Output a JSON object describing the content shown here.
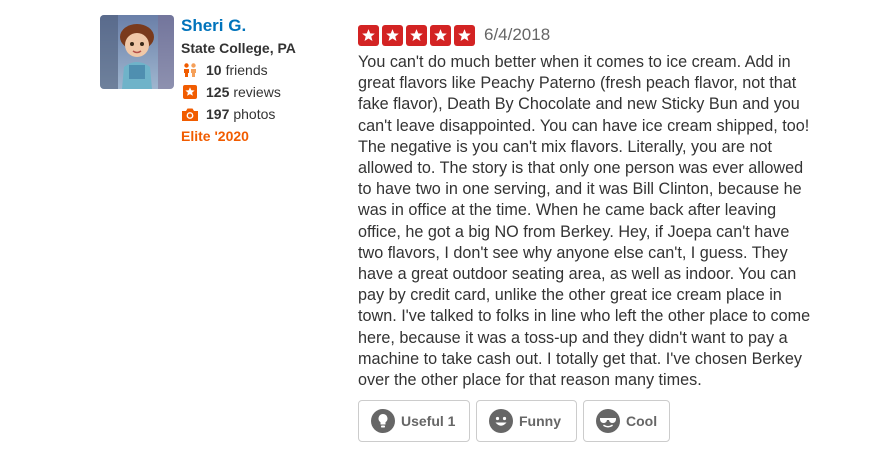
{
  "user": {
    "name": "Sheri G.",
    "location": "State College, PA",
    "friends": {
      "count": "10",
      "label": "friends",
      "icon": "friends-icon"
    },
    "reviews": {
      "count": "125",
      "label": "reviews",
      "icon": "star-icon"
    },
    "photos": {
      "count": "197",
      "label": "photos",
      "icon": "camera-icon"
    },
    "elite": "Elite '2020"
  },
  "review": {
    "rating": 5,
    "date": "6/4/2018",
    "text": "You can't do much better when it comes to ice cream. Add in\ngreat flavors like Peachy Paterno (fresh peach flavor, not that\nfake flavor), Death By Chocolate and new Sticky Bun and you\ncan't leave disappointed. You can have ice cream shipped, too!\nThe negative is you can't mix flavors. Literally, you are not\nallowed to. The story is that only one person was ever allowed\nto have two in one serving, and it was Bill Clinton, because he\nwas in office at the time. When he came back after leaving\noffice, he got a big NO from Berkey. Hey, if Joepa can't  have\ntwo flavors, I don't see why anyone else can't, I guess. They\nhave a great outdoor seating area, as well as indoor. You can\npay by credit card, unlike the other great ice cream place in\ntown. I've talked to folks in line who left the other place to come\nhere, because it was a toss-up and they didn't want to pay a\nmachine to take cash out. I totally get that. I've chosen Berkey\nover the other place for that reason many times."
  },
  "votes": {
    "useful": "Useful 1",
    "funny": "Funny",
    "cool": "Cool"
  },
  "colors": {
    "star": "#d32323",
    "name_link": "#0073bb",
    "elite": "#f15c00",
    "stat_icon": "#f15c00"
  }
}
